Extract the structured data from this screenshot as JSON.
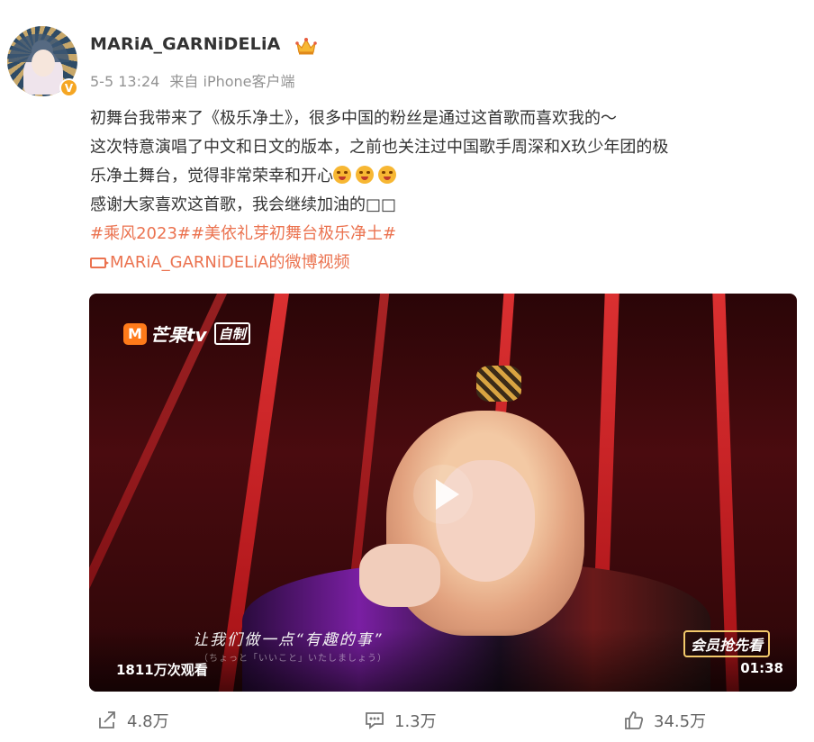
{
  "post": {
    "username": "MARiA_GARNiDELiA",
    "verified_badge": "V",
    "time": "5-5 13:24",
    "source": "来自 iPhone客户端",
    "content_lines": [
      "初舞台我带来了《极乐净土》，很多中国的粉丝是通过这首歌而喜欢我的～",
      "这次特意演唱了中文和日文的版本，之前也关注过中国歌手周深和X玖少年团的极",
      "乐净土舞台，觉得非常荣幸和开心",
      "感谢大家喜欢这首歌，我会继续加油的□□"
    ],
    "hashtags": "#乘风2023##美依礼芽初舞台极乐净土#",
    "video_link": "MARiA_GARNiDELiA的微博视频"
  },
  "video": {
    "logo_letter": "M",
    "logo_text": "芒果tv",
    "logo_tag": "自制",
    "subtitle": "让我们做一点“有趣的事”",
    "subtitle_jp": "（ちょっと「いいこと」いたしましょう）",
    "vip_label": "会员抢先看",
    "views": "1811万次观看",
    "duration": "01:38"
  },
  "actions": {
    "share_count": "4.8万",
    "comment_count": "1.3万",
    "like_count": "34.5万"
  },
  "icons": [
    "crown-icon",
    "share-icon",
    "comment-icon",
    "like-icon",
    "play-icon",
    "video-link-icon",
    "smile-emoji-icon"
  ],
  "colors": {
    "accent": "#eb7350",
    "text": "#333333",
    "meta": "#939393",
    "beam": "#ff3b3b"
  }
}
